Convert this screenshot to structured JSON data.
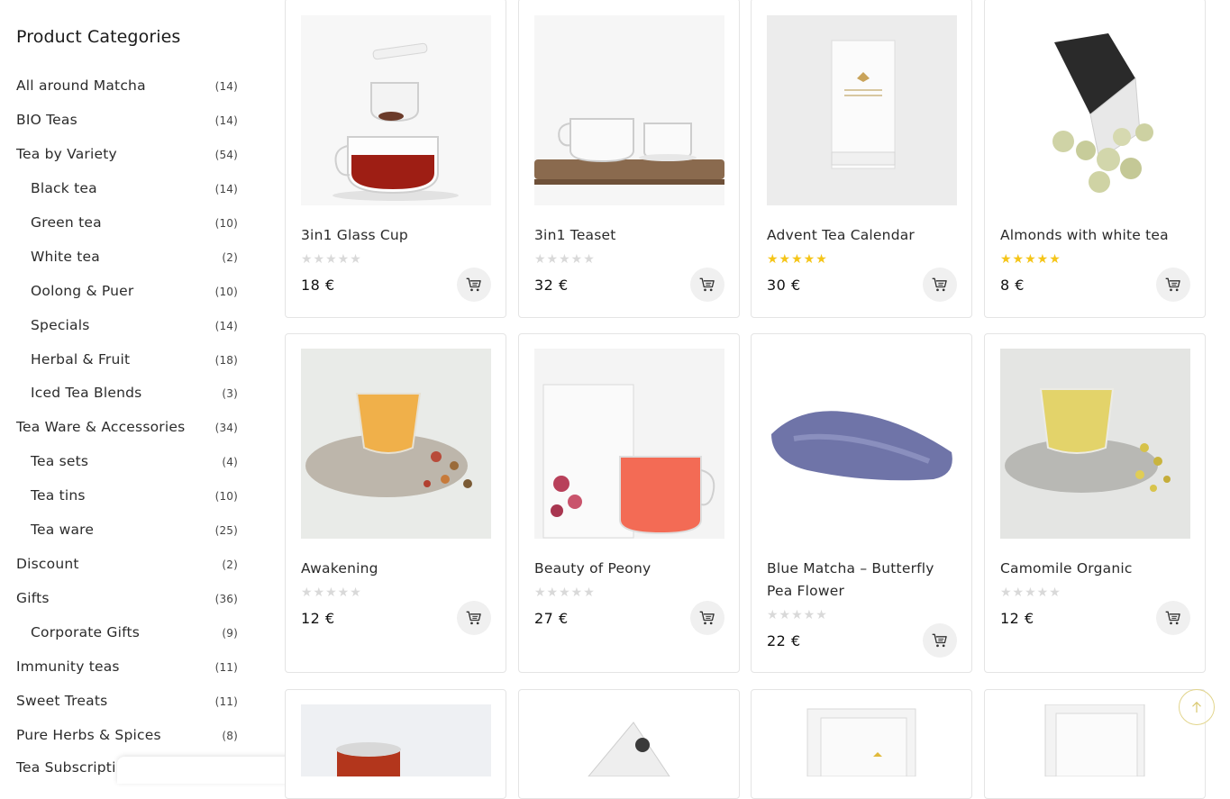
{
  "sidebar": {
    "title": "Product Categories",
    "categories": [
      {
        "label": "All around Matcha",
        "count": "(14)",
        "sub": false
      },
      {
        "label": "BIO Teas",
        "count": "(14)",
        "sub": false
      },
      {
        "label": "Tea by Variety",
        "count": "(54)",
        "sub": false
      },
      {
        "label": "Black tea",
        "count": "(14)",
        "sub": true
      },
      {
        "label": "Green tea",
        "count": "(10)",
        "sub": true
      },
      {
        "label": "White tea",
        "count": "(2)",
        "sub": true
      },
      {
        "label": "Oolong & Puer",
        "count": "(10)",
        "sub": true
      },
      {
        "label": "Specials",
        "count": "(14)",
        "sub": true
      },
      {
        "label": "Herbal & Fruit",
        "count": "(18)",
        "sub": true
      },
      {
        "label": "Iced Tea Blends",
        "count": "(3)",
        "sub": true
      },
      {
        "label": "Tea Ware & Accessories",
        "count": "(34)",
        "sub": false
      },
      {
        "label": "Tea sets",
        "count": "(4)",
        "sub": true
      },
      {
        "label": "Tea tins",
        "count": "(10)",
        "sub": true
      },
      {
        "label": "Tea ware",
        "count": "(25)",
        "sub": true
      },
      {
        "label": "Discount",
        "count": "(2)",
        "sub": false
      },
      {
        "label": "Gifts",
        "count": "(36)",
        "sub": false
      },
      {
        "label": "Corporate Gifts",
        "count": "(9)",
        "sub": true
      },
      {
        "label": "Immunity teas",
        "count": "(11)",
        "sub": false
      },
      {
        "label": "Sweet Treats",
        "count": "(11)",
        "sub": false
      },
      {
        "label": "Pure Herbs & Spices",
        "count": "(8)",
        "sub": false
      },
      {
        "label": "Tea Subscripti",
        "count": "",
        "sub": false
      }
    ]
  },
  "products": [
    {
      "name": "3in1 Glass Cup",
      "price": "18 €",
      "rating": 0
    },
    {
      "name": "3in1 Teaset",
      "price": "32 €",
      "rating": 0
    },
    {
      "name": "Advent Tea Calendar",
      "price": "30 €",
      "rating": 5
    },
    {
      "name": "Almonds with white tea",
      "price": "8 €",
      "rating": 5
    },
    {
      "name": "Awakening",
      "price": "12 €",
      "rating": 0
    },
    {
      "name": "Beauty of Peony",
      "price": "27 €",
      "rating": 0
    },
    {
      "name": "Blue Matcha – Butterfly Pea Flower",
      "price": "22 €",
      "rating": 0
    },
    {
      "name": "Camomile Organic",
      "price": "12 €",
      "rating": 0
    }
  ],
  "stars_glyphs": "★★★★★",
  "colors": {
    "star_filled": "#f5c518",
    "star_empty": "#d9d9d9",
    "cart_bg": "#f0f0f0",
    "back_to_top_ring": "#e2d58c"
  },
  "icons": {
    "cart": "cart-icon",
    "back_to_top": "arrow-up-icon"
  }
}
